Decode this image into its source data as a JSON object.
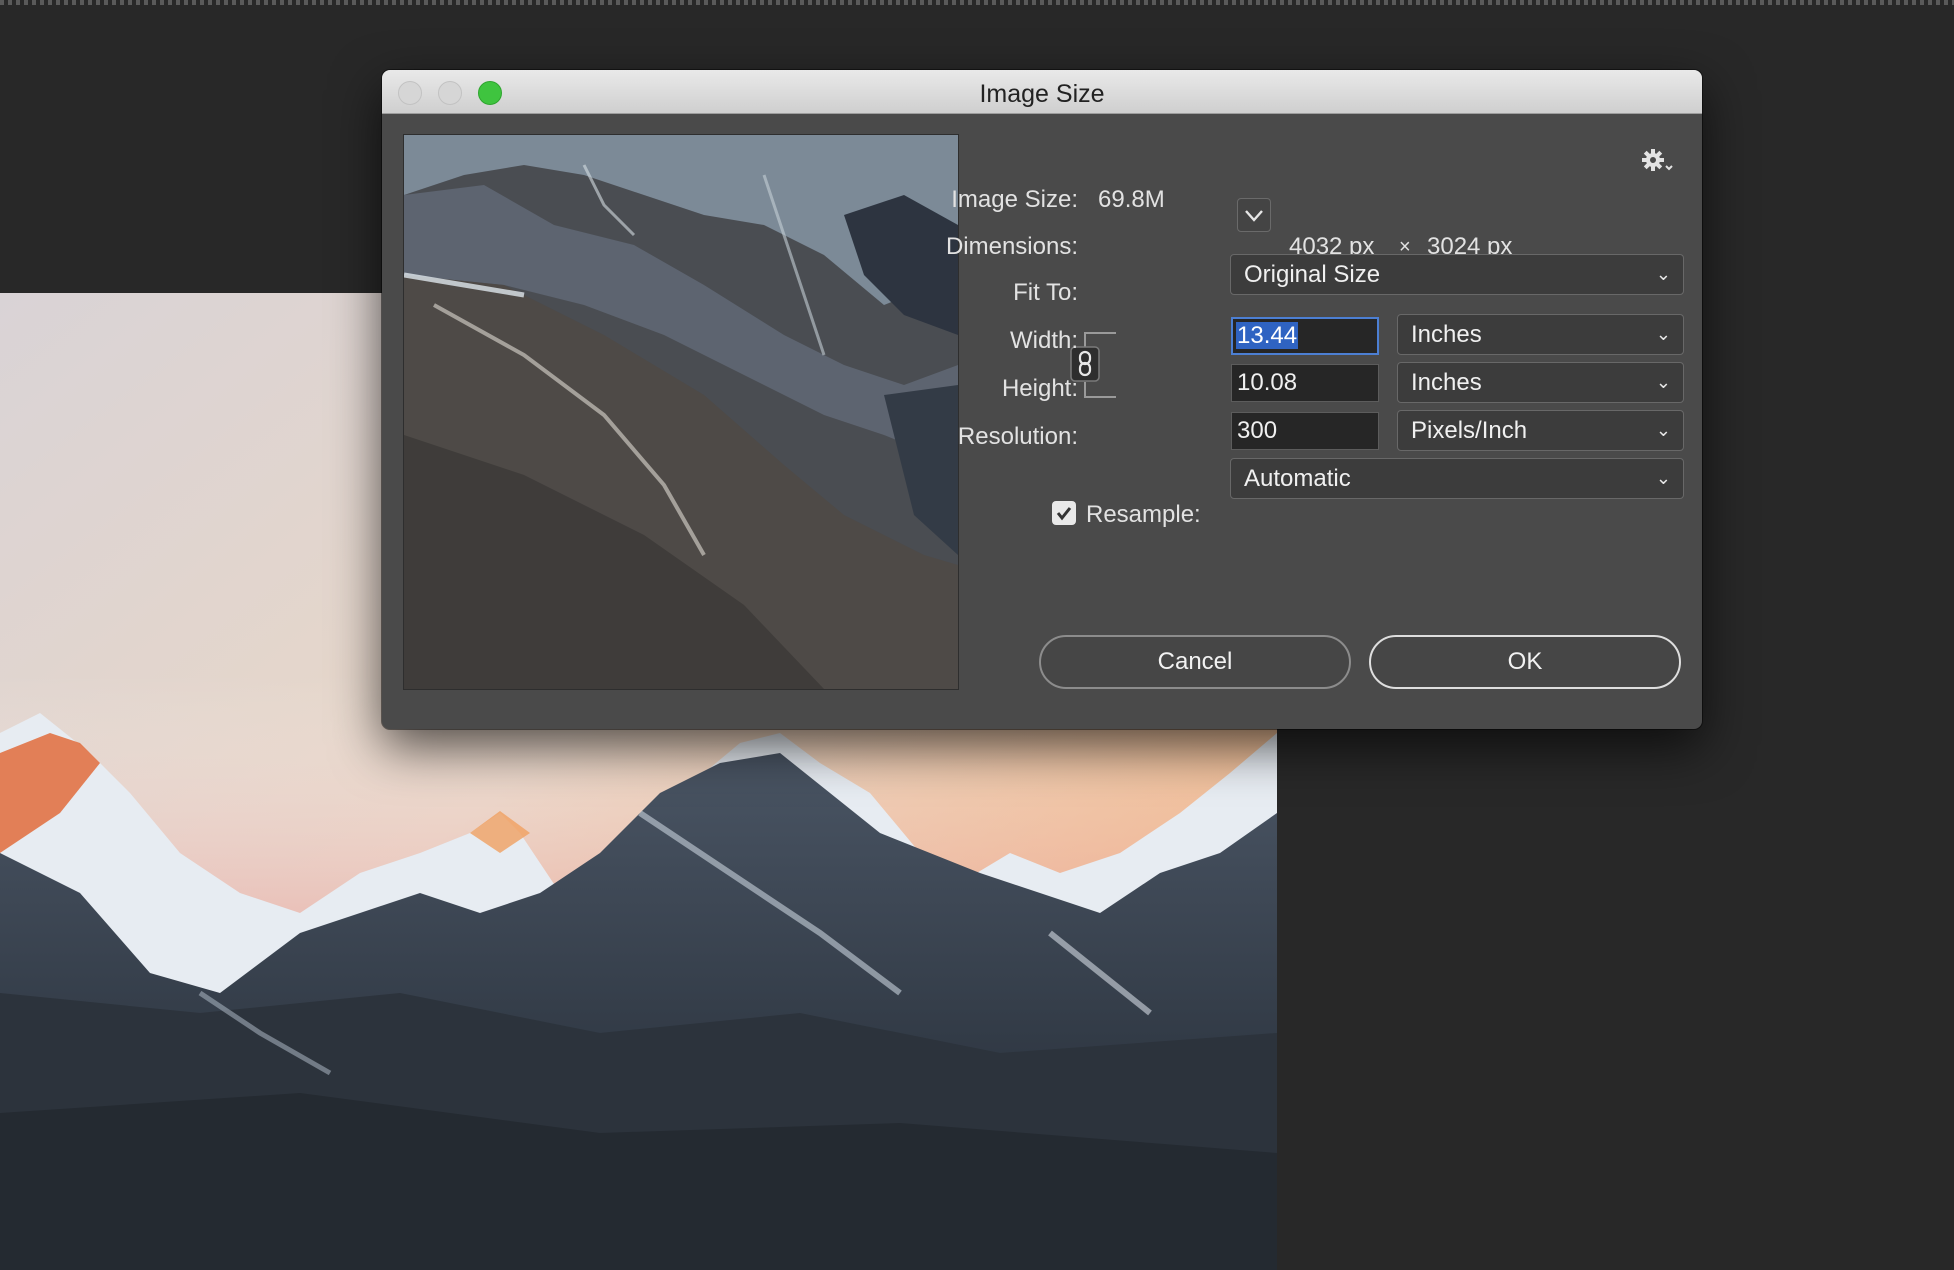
{
  "dialog": {
    "title": "Image Size"
  },
  "image_size": {
    "label": "Image Size:",
    "value": "69.8M"
  },
  "dimensions": {
    "label": "Dimensions:",
    "width": "4032 px",
    "times": "×",
    "height": "3024 px"
  },
  "fit_to": {
    "label": "Fit To:",
    "value": "Original Size"
  },
  "width": {
    "label": "Width:",
    "value": "13.44",
    "unit": "Inches"
  },
  "height": {
    "label": "Height:",
    "value": "10.08",
    "unit": "Inches"
  },
  "resolution": {
    "label": "Resolution:",
    "value": "300",
    "unit": "Pixels/Inch"
  },
  "resample": {
    "label": "Resample:",
    "checked": true,
    "value": "Automatic"
  },
  "buttons": {
    "cancel": "Cancel",
    "ok": "OK"
  },
  "icons": {
    "settings": "gear-icon",
    "dropdown": "chevron-down-icon",
    "link": "chain-link-icon",
    "checkbox": "checkmark-icon"
  },
  "colors": {
    "focus": "#4c7fd3",
    "selection": "#2f63c2",
    "zoom_light": "#3fc43f"
  }
}
